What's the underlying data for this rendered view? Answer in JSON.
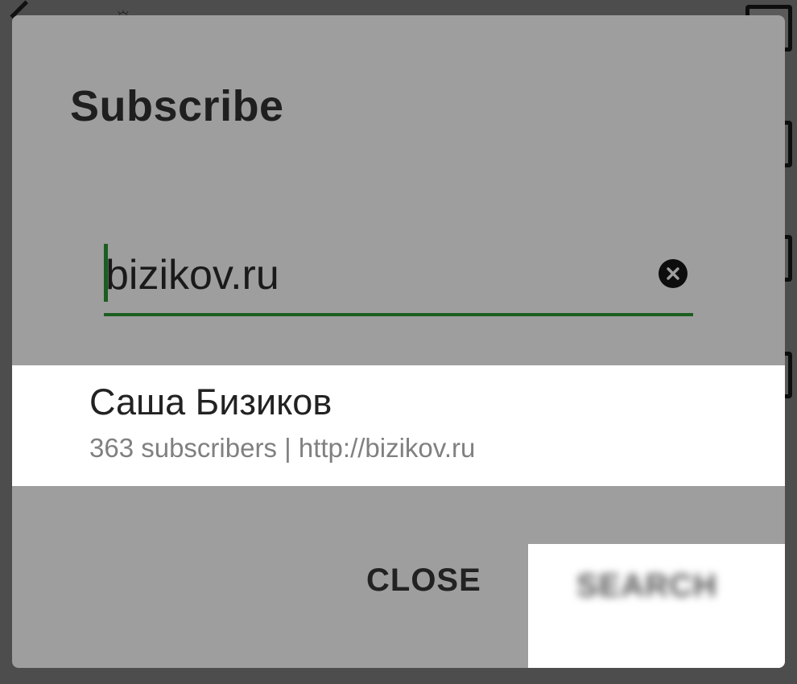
{
  "dialog": {
    "title": "Subscribe",
    "search_input": {
      "value": "bizikov.ru",
      "placeholder": ""
    },
    "result": {
      "name": "Саша Бизиков",
      "meta": "363 subscribers | http://bizikov.ru"
    },
    "actions": {
      "close_label": "CLOSE",
      "search_label": "SEARCH"
    }
  },
  "colors": {
    "accent": "#1b5e20",
    "dialog_bg": "#9e9e9e",
    "scrim": "#4d4d4d"
  },
  "icons": {
    "clear": "clear-circle-icon"
  }
}
